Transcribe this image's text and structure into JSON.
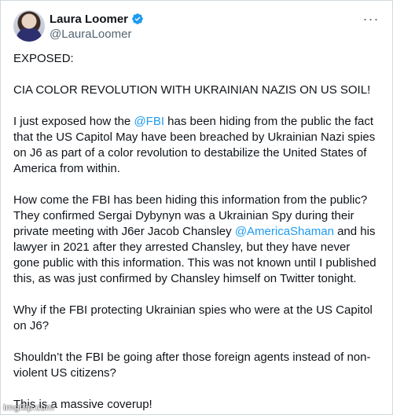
{
  "author": {
    "display_name": "Laura Loomer",
    "handle": "@LauraLoomer",
    "verified": true,
    "avatar": "avatar-photo"
  },
  "menu": {
    "icon": "more-horizontal-icon",
    "label": "···"
  },
  "tweet": {
    "p1": "EXPOSED:",
    "p2": "CIA COLOR REVOLUTION WITH UKRAINIAN NAZIS ON US SOIL!",
    "p3_before": "I just exposed how the ",
    "p3_mention": "@FBI",
    "p3_after": " has been hiding from the public the fact that the US Capitol May have been breached by Ukrainian Nazi spies on J6 as part of a color revolution to destabilize the United States of America from within.",
    "p4_before": "How come the FBI has been hiding this information from the public? They confirmed Sergai Dybynyn was a Ukrainian Spy during their private meeting with J6er Jacob Chansley ",
    "p4_mention": "@AmericaShaman",
    "p4_after": " and his lawyer in 2021 after they arrested Chansley, but they have never gone public with this information. This was not known until I published this, as was just confirmed by Chansley himself on Twitter tonight.",
    "p5": "Why if the FBI protecting Ukrainian spies who were at the US Capitol on J6?",
    "p6": "Shouldn’t the FBI be going after those foreign agents instead of non-violent US citizens?",
    "p7": "This is a massive coverup!"
  },
  "colors": {
    "link": "#1d9bf0",
    "verified_badge": "#1d9bf0",
    "secondary_text": "#536471",
    "primary_text": "#0f1419"
  },
  "watermark": "imgflip.com"
}
